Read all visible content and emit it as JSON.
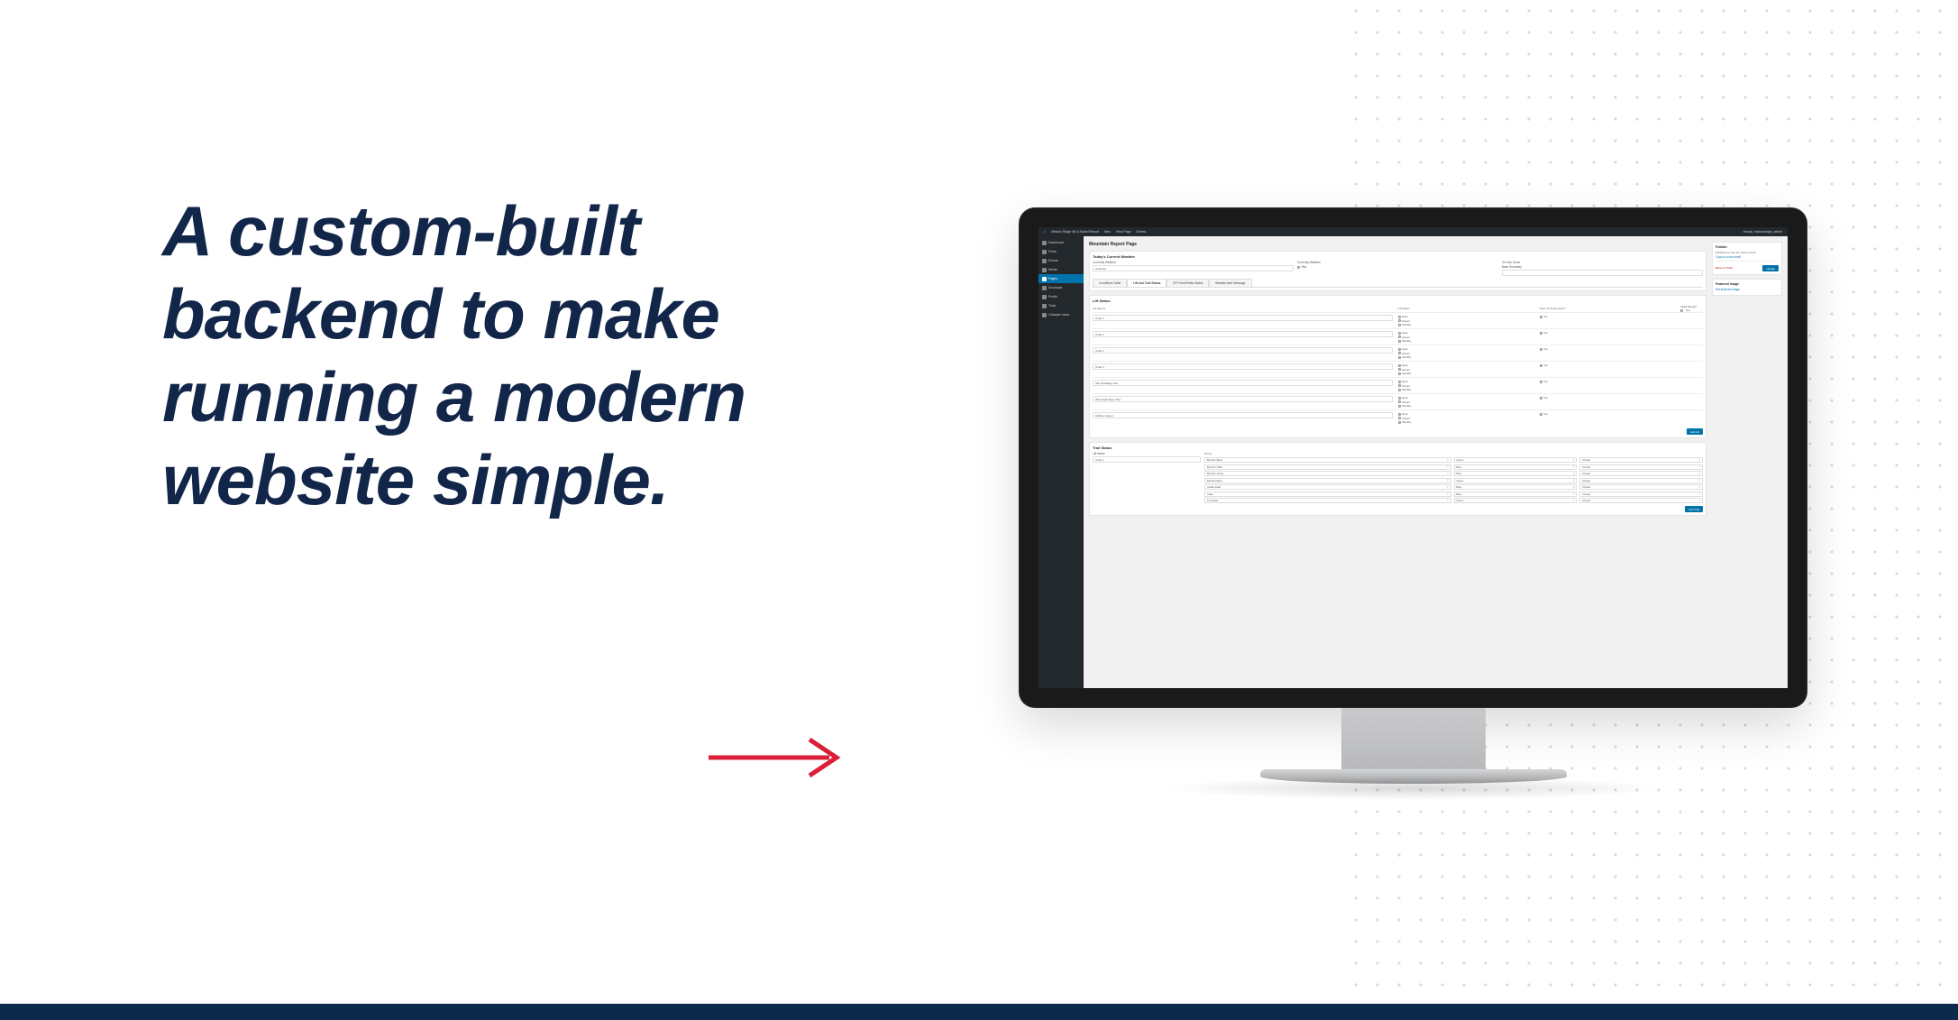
{
  "headline": "A custom-built backend to make running a modern website simple.",
  "adminbar": {
    "site": "Mission Ridge Ski & Board Resort",
    "items": [
      "New",
      "View Page",
      "Events"
    ],
    "user": "Howdy, missionridge_admin"
  },
  "sidebar_menu": [
    "Dashboard",
    "Posts",
    "Events",
    "Media",
    "Pages",
    "Snowcast",
    "Profile",
    "Tools",
    "Collapse menu"
  ],
  "active_menu_index": 4,
  "page_title": "Mountain Report Page",
  "section1": {
    "header": "Today's Current Weather",
    "weather_label": "Overcast",
    "column_weather_label": "Currently Weather",
    "column_yes_label": "Yes",
    "column_24_label": "24 Hour Snow",
    "column_base_label": "Base Summary"
  },
  "tabs": [
    "Conditions Table",
    "Lift and Trail Status",
    "CPI Feed/Parks Status",
    "Website Alert Message"
  ],
  "active_tab_index": 1,
  "lift_table": {
    "title": "Lift Status",
    "cols": [
      "Lift Names",
      "Lift Status",
      "Open for Book Open?"
    ],
    "status_options": [
      "Open",
      "Closed",
      "Standby"
    ],
    "open_book_options": [
      "Yes"
    ],
    "rows": [
      {
        "name": "Chair 1",
        "status": 0,
        "book": 0
      },
      {
        "name": "Chair 2",
        "status": 0,
        "book": 0
      },
      {
        "name": "Chair 3",
        "status": 0,
        "book": 0
      },
      {
        "name": "Chair 4",
        "status": 0,
        "book": 0
      },
      {
        "name": "Ski Lift/Village Tow",
        "status": 0,
        "book": 0
      },
      {
        "name": "Wee Peak Rope Tow",
        "status": 0,
        "book": 0
      },
      {
        "name": "Kiddies Carpet",
        "status": 0,
        "book": 0
      }
    ],
    "button": "Add Lift"
  },
  "night": {
    "label": "Night Skiing?",
    "option": "Yes"
  },
  "trail_table": {
    "title": "Trail Status",
    "lift_col": "Lift Name",
    "lift_value": "Chair 1",
    "cols": [
      "Name",
      "",
      ""
    ],
    "rows": [
      {
        "name": "Bomber Bowl",
        "a": "Green",
        "b": "Closed"
      },
      {
        "name": "Bomber Cliffs",
        "a": "Blue",
        "b": "Closed"
      },
      {
        "name": "Bomber Chute",
        "a": "Blue",
        "b": "Closed"
      },
      {
        "name": "Bomber Bowl",
        "a": "Green",
        "b": "Closed"
      },
      {
        "name": "Castle Peak",
        "a": "Blue",
        "b": "Closed"
      },
      {
        "name": "Chak",
        "a": "Blue",
        "b": "Closed"
      },
      {
        "name": "Tumwater",
        "a": "Green",
        "b": "Closed"
      }
    ],
    "button": "Add Trail"
  },
  "aside": {
    "publish": {
      "title": "Publish",
      "date": "Published on Sep 24, 2019 at 10:30",
      "link1": "Copy to a new draft",
      "link2": "Move to Trash",
      "button": "Update"
    },
    "featured": {
      "title": "Featured Image",
      "link": "Set featured image"
    }
  }
}
